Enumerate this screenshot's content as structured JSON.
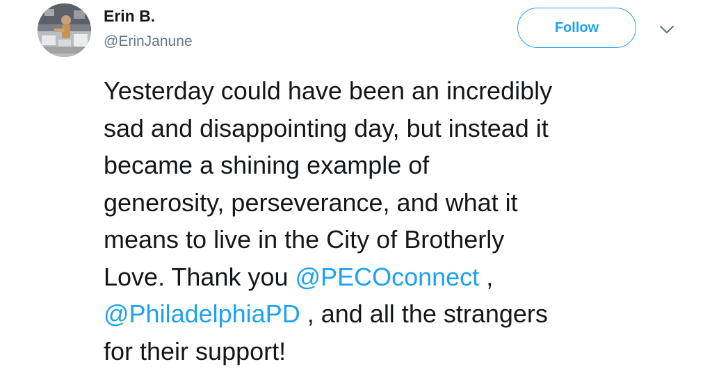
{
  "author": {
    "name": "Erin B.",
    "handle": "@ErinJanune",
    "avatar_icon": "profile-photo"
  },
  "actions": {
    "follow_label": "Follow",
    "menu_icon": "chevron-down-icon"
  },
  "tweet": {
    "lines": [
      "Yesterday could have been an incredibly",
      "sad and disappointing day, but instead it",
      "became a shining example of",
      "generosity, perseverance, and what it",
      "means to live in the City of Brotherly",
      "Love. Thank you "
    ],
    "mention_1": "@PECOconnect",
    "after_mention_1": " ,",
    "mention_2": "@PhiladelphiaPD",
    "after_mention_2": " , and all the strangers",
    "last_line": "for their support!"
  },
  "colors": {
    "accent": "#1da1f2",
    "text": "#14171a",
    "secondary": "#657786"
  }
}
